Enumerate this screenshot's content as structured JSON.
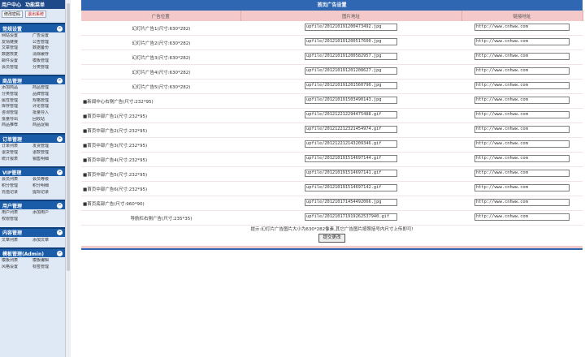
{
  "sidebar": {
    "top_links": [
      "用户中心",
      "功能菜单"
    ],
    "top_buttons": [
      "修改密码",
      "退出系统"
    ],
    "groups": [
      {
        "title": "常规设置",
        "items": [
          "网站设置",
          "广告设置",
          "友情链接",
          "公告管理",
          "文章管理",
          "数据备份",
          "数据恢复",
          "清除缓存",
          "邮件设置",
          "模板管理",
          "会员管理",
          "分类管理"
        ]
      },
      {
        "title": "商品管理",
        "items": [
          "添加商品",
          "商品管理",
          "分类管理",
          "品牌管理",
          "属性管理",
          "规格管理",
          "库存管理",
          "评论管理",
          "咨询管理",
          "批量导入",
          "批量导出",
          "回收站",
          "商品推荐",
          "商品促销"
        ]
      },
      {
        "title": "订单管理",
        "items": [
          "订单列表",
          "发货管理",
          "退货管理",
          "退款管理",
          "统计报表",
          "销售明细"
        ]
      },
      {
        "title": "VIP管理",
        "items": [
          "会员列表",
          "会员等级",
          "积分管理",
          "积分明细",
          "充值记录",
          "提现记录"
        ]
      },
      {
        "title": "用户管理",
        "items": [
          "用户列表",
          "添加用户",
          "权限管理"
        ]
      },
      {
        "title": "内容管理",
        "items": [
          "文章列表",
          "添加文章"
        ]
      },
      {
        "title": "模板管理(Admin)",
        "items": [
          "模板列表",
          "模板编辑",
          "风格设置",
          "标签管理"
        ]
      }
    ]
  },
  "main": {
    "title": "首页广告设置",
    "headers": [
      "广告位置",
      "图片地址",
      "链接地址"
    ],
    "rows": [
      {
        "position": "幻灯片广告1(尺寸:630*282)",
        "image": "upfile/201210191200473492.jpg",
        "link": "http://www.cnhww.com"
      },
      {
        "position": "幻灯片广告2(尺寸:630*282)",
        "image": "upfile/201210191200517600.jpg",
        "link": "http://www.cnhww.com"
      },
      {
        "position": "幻灯片广告3(尺寸:630*282)",
        "image": "upfile/201210191200582957.jpg",
        "link": "http://www.cnhww.com"
      },
      {
        "position": "幻灯片广告4(尺寸:630*282)",
        "image": "upfile/201210191201208627.jpg",
        "link": "http://www.cnhww.com"
      },
      {
        "position": "幻灯片广告5(尺寸:630*282)",
        "image": "upfile/201210191201560790.jpg",
        "link": "http://www.cnhww.com"
      },
      {
        "position": "■新闻中心右侧广告(尺寸:232*95)",
        "image": "upfile/201210191503490143.jpg",
        "link": "http://www.cnhww.com"
      },
      {
        "position": "■首页中部广告1(尺寸:232*95)",
        "image": "upfile/201212212294475488.gif",
        "link": "http://www.cnhww.com"
      },
      {
        "position": "■首页中部广告2(尺寸:232*95)",
        "image": "upfile/201212212321454974.gif",
        "link": "http://www.cnhww.com"
      },
      {
        "position": "■首页中部广告3(尺寸:232*95)",
        "image": "upfile/201212212143209346.gif",
        "link": "http://www.cnhww.com"
      },
      {
        "position": "■首页中部广告4(尺寸:232*95)",
        "image": "upfile/201210191514697144.gif",
        "link": "http://www.cnhww.com"
      },
      {
        "position": "■首页中部广告5(尺寸:232*95)",
        "image": "upfile/201210191514697141.gif",
        "link": "http://www.cnhww.com"
      },
      {
        "position": "■首页中部广告6(尺寸:232*95)",
        "image": "upfile/201210191514697142.gif",
        "link": "http://www.cnhww.com"
      },
      {
        "position": "■首页底部广告(尺寸:960*90)",
        "image": "upfile/201210171454492066.jpg",
        "link": "http://www.cnhww.com"
      },
      {
        "position": "导航栏右侧广告(尺寸:235*35)",
        "image": "upfile/201210171919262537940.gif",
        "link": "http://www.cnhww.com"
      }
    ],
    "note": "提示:幻灯片广告图片大小为630*282像素,其它广告图片按照括号内尺寸上传即可!",
    "submit_label": "提交更改"
  }
}
